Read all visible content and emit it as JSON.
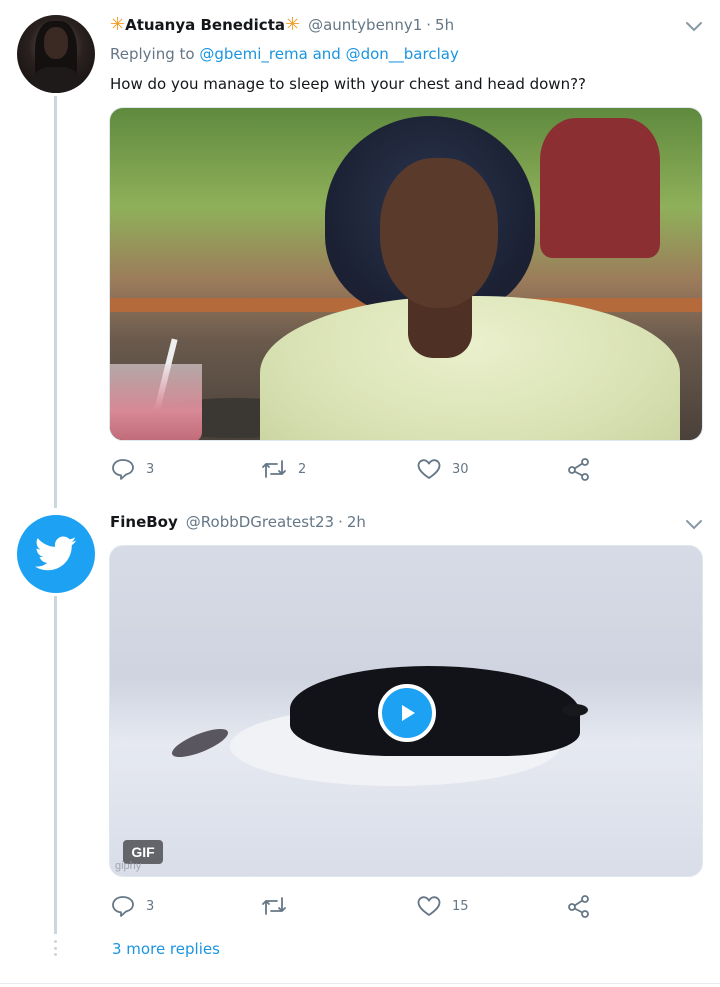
{
  "tweet1": {
    "display_name": "Atuanya Benedicta",
    "name_decoration": "✳",
    "handle": "@auntybenny1",
    "separator": "·",
    "time": "5h",
    "replying_prefix": "Replying to",
    "replying_user1": "@gbemi_rema",
    "replying_and": "and",
    "replying_user2": "@don__barclay",
    "text": "How do you manage to sleep with your chest and head down??",
    "media_alt": "reaction image",
    "stats": {
      "replies": "3",
      "retweets": "2",
      "likes": "30"
    }
  },
  "tweet2": {
    "display_name": "FineBoy",
    "handle": "@RobbDGreatest23",
    "separator": "·",
    "time": "2h",
    "gif_label": "GIF",
    "gif_watermark": "giphy",
    "stats": {
      "replies": "3",
      "retweets": "",
      "likes": "15"
    }
  },
  "thread": {
    "more_replies": "3 more replies"
  },
  "icons": {
    "reply": "reply-icon",
    "retweet": "retweet-icon",
    "like": "heart-icon",
    "share": "share-icon",
    "chevron": "chevron-down-icon",
    "play": "play-icon",
    "bird": "twitter-bird-icon"
  },
  "colors": {
    "accent": "#1da1f2",
    "link": "#1b95e0",
    "muted": "#657786",
    "decoration": "#f59c24"
  }
}
